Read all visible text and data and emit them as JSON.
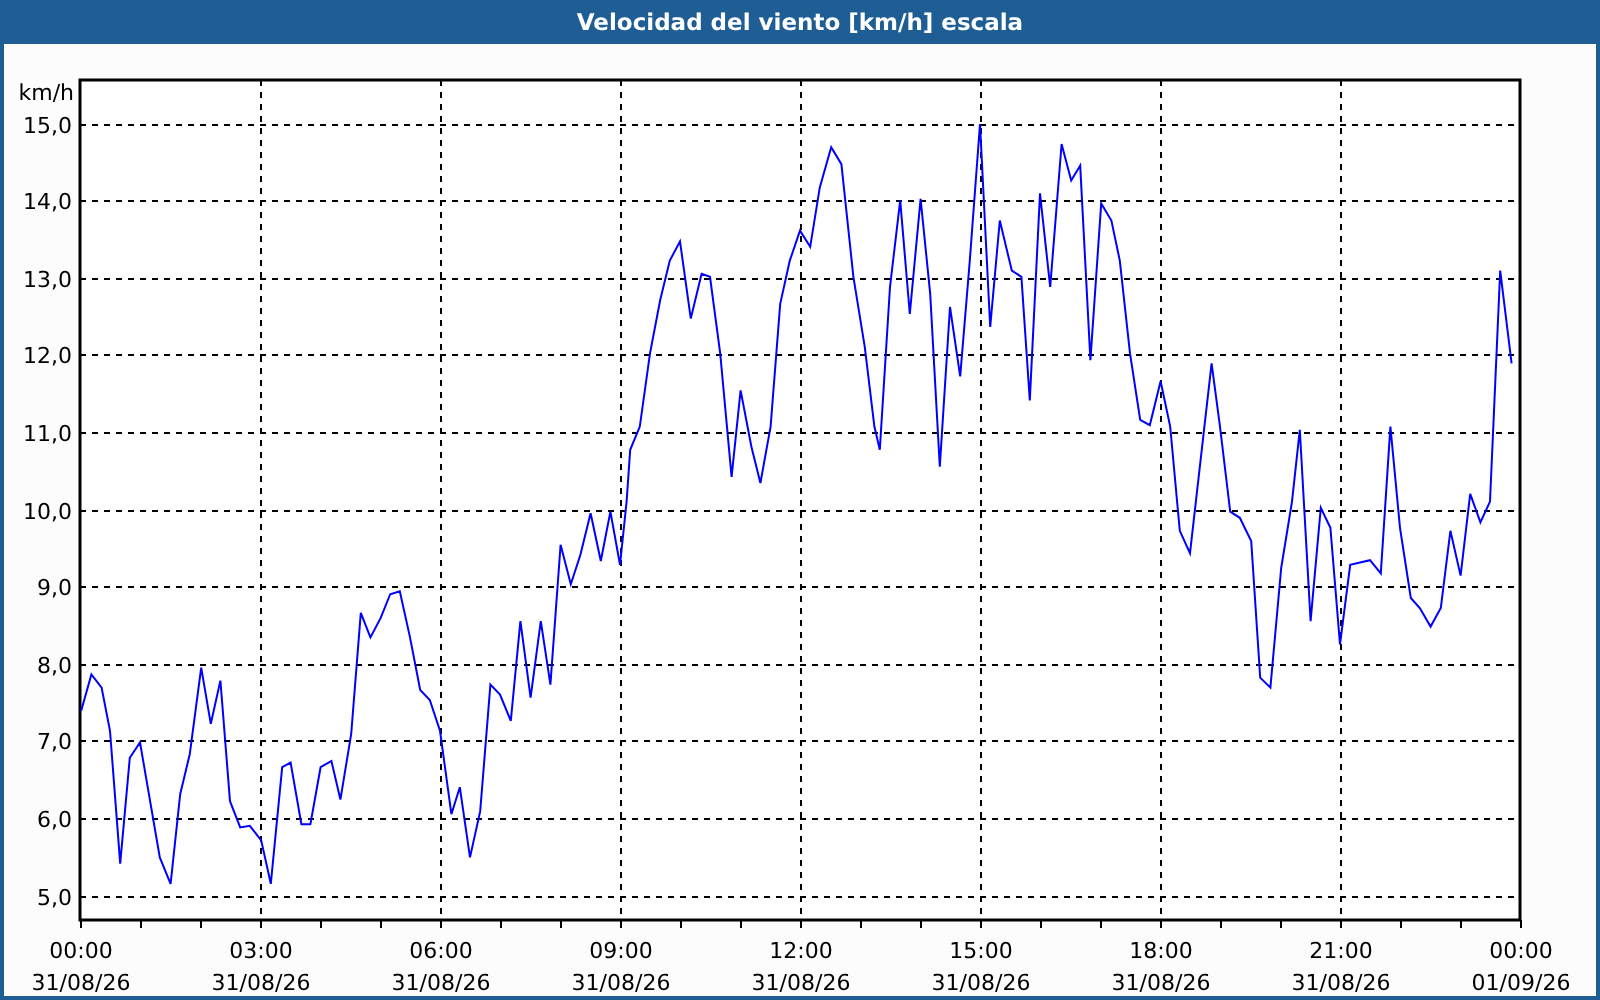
{
  "window": {
    "title": "Velocidad del viento [km/h] escala"
  },
  "chart": {
    "x_date_labels": [
      "31/08/26",
      "31/08/26",
      "31/08/26",
      "31/08/26",
      "31/08/26",
      "31/08/26",
      "31/08/26",
      "31/08/26",
      "01/09/26"
    ],
    "chart_data": {
      "type": "line",
      "grid": true,
      "ylabel": "km/h",
      "xlim": [
        0,
        24
      ],
      "ylim": [
        4.68,
        15.56
      ],
      "xticks": [
        {
          "value": 0,
          "label": "00:00"
        },
        {
          "value": 3,
          "label": "03:00"
        },
        {
          "value": 6,
          "label": "06:00"
        },
        {
          "value": 9,
          "label": "09:00"
        },
        {
          "value": 12,
          "label": "12:00"
        },
        {
          "value": 15,
          "label": "15:00"
        },
        {
          "value": 18,
          "label": "18:00"
        },
        {
          "value": 21,
          "label": "21:00"
        },
        {
          "value": 24,
          "label": "00:00"
        }
      ],
      "yticks": [
        {
          "value": 5,
          "label": "5,0"
        },
        {
          "value": 6,
          "label": "6,0"
        },
        {
          "value": 7,
          "label": "7,0"
        },
        {
          "value": 8,
          "label": "8,0"
        },
        {
          "value": 9,
          "label": "9,0"
        },
        {
          "value": 10,
          "label": "10,0"
        },
        {
          "value": 11,
          "label": "11,0"
        },
        {
          "value": 12,
          "label": "12,0"
        },
        {
          "value": 13,
          "label": "13,0"
        },
        {
          "value": 14,
          "label": "14,0"
        },
        {
          "value": 15,
          "label": "15,0"
        }
      ],
      "x": [
        0.02,
        0.19,
        0.36,
        0.5,
        0.67,
        0.83,
        1.0,
        1.33,
        1.51,
        1.67,
        1.83,
        2.02,
        2.18,
        2.34,
        2.5,
        2.67,
        2.83,
        3.02,
        3.18,
        3.37,
        3.51,
        3.69,
        3.84,
        4.01,
        4.19,
        4.34,
        4.52,
        4.68,
        4.84,
        5.01,
        5.17,
        5.33,
        5.5,
        5.67,
        5.83,
        6.0,
        6.19,
        6.33,
        6.5,
        6.67,
        6.84,
        7.0,
        7.18,
        7.34,
        7.51,
        7.68,
        7.84,
        8.01,
        8.18,
        8.34,
        8.51,
        8.68,
        8.84,
        9.0,
        9.11,
        9.17,
        9.33,
        9.5,
        9.67,
        9.83,
        10.0,
        10.18,
        10.36,
        10.5,
        10.67,
        10.86,
        11.01,
        11.19,
        11.34,
        11.51,
        11.67,
        11.83,
        12.0,
        12.17,
        12.33,
        12.52,
        12.69,
        12.89,
        13.08,
        13.24,
        13.33,
        13.5,
        13.67,
        13.83,
        14.01,
        14.17,
        14.33,
        14.5,
        14.67,
        14.83,
        15.0,
        15.17,
        15.33,
        15.53,
        15.69,
        15.83,
        16.0,
        16.17,
        16.36,
        16.52,
        16.67,
        16.84,
        17.02,
        17.19,
        17.33,
        17.5,
        17.67,
        17.83,
        18.01,
        18.17,
        18.33,
        18.5,
        18.86,
        19.0,
        19.17,
        19.33,
        19.52,
        19.67,
        19.84,
        20.02,
        20.2,
        20.33,
        20.51,
        20.68,
        20.84,
        21.0,
        21.17,
        21.5,
        21.68,
        21.84,
        22.0,
        22.18,
        22.33,
        22.51,
        22.68,
        22.84,
        23.01,
        23.17,
        23.34,
        23.5,
        23.67,
        23.86
      ],
      "series": [
        {
          "color": "#0000ff",
          "values": [
            7.39,
            7.86,
            7.69,
            7.13,
            5.41,
            6.78,
            6.98,
            5.49,
            5.15,
            6.31,
            6.83,
            7.95,
            7.22,
            7.78,
            6.22,
            5.88,
            5.9,
            5.71,
            5.15,
            6.66,
            6.72,
            5.92,
            5.92,
            6.66,
            6.74,
            6.24,
            7.09,
            8.66,
            8.34,
            8.59,
            8.9,
            8.94,
            8.34,
            7.66,
            7.53,
            7.13,
            6.05,
            6.4,
            5.49,
            6.09,
            7.73,
            7.6,
            7.26,
            8.55,
            7.56,
            8.55,
            7.73,
            9.54,
            9.03,
            9.41,
            9.95,
            9.33,
            9.97,
            9.28,
            10.1,
            10.77,
            11.07,
            12.02,
            12.71,
            13.22,
            13.47,
            12.47,
            13.05,
            13.01,
            12.02,
            10.42,
            11.54,
            10.81,
            10.34,
            11.07,
            12.66,
            13.22,
            13.61,
            13.4,
            14.17,
            14.69,
            14.47,
            13.01,
            12.1,
            11.07,
            10.77,
            12.88,
            14.0,
            12.53,
            14.02,
            12.79,
            10.55,
            12.62,
            11.72,
            13.22,
            14.99,
            12.36,
            13.74,
            13.09,
            13.01,
            11.41,
            14.09,
            12.88,
            14.73,
            14.26,
            14.45,
            11.93,
            13.96,
            13.74,
            13.22,
            12.02,
            11.16,
            11.09,
            11.66,
            11.07,
            9.72,
            9.43,
            11.89,
            11.07,
            9.97,
            9.89,
            9.59,
            7.82,
            7.69,
            9.24,
            10.1,
            11.03,
            8.55,
            10.02,
            9.76,
            8.25,
            9.28,
            9.34,
            9.17,
            11.07,
            9.76,
            8.85,
            8.72,
            8.48,
            8.72,
            9.72,
            9.14,
            10.2,
            9.83,
            10.1,
            13.09,
            11.89
          ]
        }
      ]
    }
  }
}
